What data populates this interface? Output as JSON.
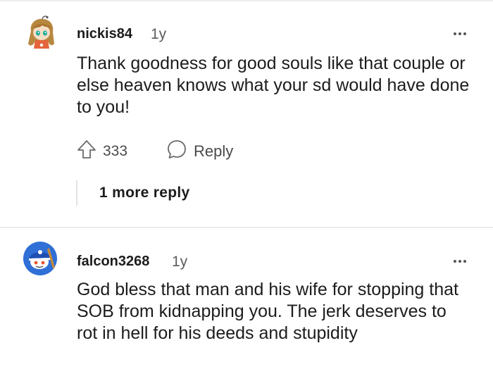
{
  "comments": [
    {
      "username": "nickis84",
      "age": "1y",
      "avatar_icon": "anime-girl-avatar-icon",
      "text": "Thank goodness for good souls like that couple or else heaven knows what your sd would have done to you!",
      "upvote_icon": "upvote-arrow-icon",
      "votes": "333",
      "reply_icon": "speech-bubble-icon",
      "reply_label": "Reply",
      "more_replies": "1 more reply",
      "more_icon": "ellipsis-icon"
    },
    {
      "username": "falcon3268",
      "age": "1y",
      "avatar_icon": "blue-cap-snoo-avatar-icon",
      "text": "God bless that man and his wife for stopping that SOB from kidnapping you. The jerk deserves to rot in hell for his deeds and stupidity",
      "more_icon": "ellipsis-icon"
    }
  ],
  "colors": {
    "text": "#1c1c1c",
    "meta": "#5c5c5c",
    "divider": "#ececec",
    "avatar2_bg": "#2f6fd6"
  }
}
